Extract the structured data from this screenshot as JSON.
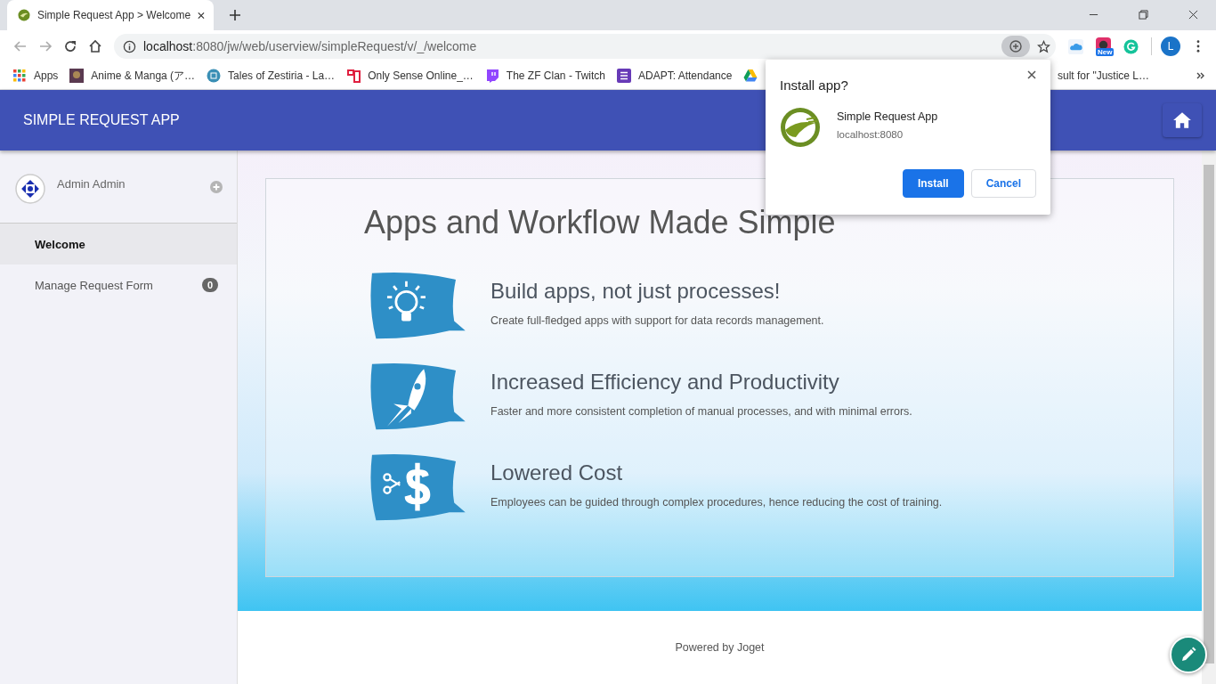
{
  "browser": {
    "tab": {
      "title": "Simple Request App > Welcome",
      "selected": true
    },
    "address": {
      "host": "localhost",
      "path": ":8080/jw/web/userview/simpleRequest/v/_/welcome"
    },
    "extension_badge": "New",
    "profile_initial": "L",
    "bookmarks": [
      {
        "label": "Apps",
        "kind": "apps"
      },
      {
        "label": "Anime & Manga (ア…",
        "kind": "anime"
      },
      {
        "label": "Tales of Zestiria - La…",
        "kind": "zestiria"
      },
      {
        "label": "Only Sense Online_…",
        "kind": "oso"
      },
      {
        "label": "The ZF Clan - Twitch",
        "kind": "twitch"
      },
      {
        "label": "ADAPT: Attendance",
        "kind": "forms"
      },
      {
        "kind": "drive"
      },
      {
        "label": "sult for \"Justice L…",
        "kind": "cut"
      }
    ]
  },
  "install_popup": {
    "title": "Install app?",
    "app_name": "Simple Request App",
    "origin": "localhost:8080",
    "buttons": [
      {
        "label": "Install",
        "kind": "primary"
      },
      {
        "label": "Cancel",
        "kind": "secondary"
      }
    ]
  },
  "header": {
    "title": "SIMPLE REQUEST APP"
  },
  "sidebar": {
    "user": "Admin Admin",
    "items": [
      {
        "label": "Welcome",
        "selected": true
      },
      {
        "label": "Manage Request Form",
        "selected": false,
        "badge": "0"
      }
    ]
  },
  "content": {
    "heading": "Apps and Workflow Made Simple",
    "features": [
      {
        "kind": "bulb",
        "title": "Build apps, not just processes!",
        "text": "Create full-fledged apps with support for data records management."
      },
      {
        "kind": "rocket",
        "title": "Increased Efficiency and Productivity",
        "text": "Faster and more consistent completion of manual processes, and with minimal errors."
      },
      {
        "kind": "cost",
        "title": "Lowered Cost",
        "text": "Employees can be guided through complex procedures, hence reducing the cost of training."
      }
    ]
  },
  "footer": "Powered by Joget"
}
